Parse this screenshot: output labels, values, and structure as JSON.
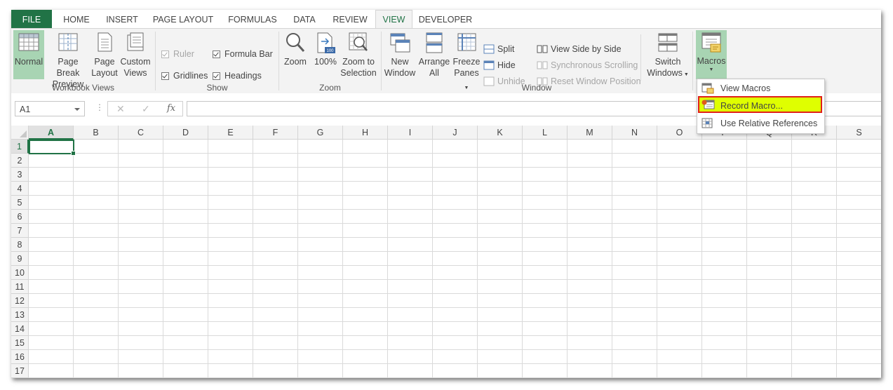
{
  "tabs": [
    "FILE",
    "HOME",
    "INSERT",
    "PAGE LAYOUT",
    "FORMULAS",
    "DATA",
    "REVIEW",
    "VIEW",
    "DEVELOPER"
  ],
  "active_tab": "VIEW",
  "ribbon": {
    "workbook_views": {
      "label": "Workbook Views",
      "normal": "Normal",
      "page_break_1": "Page Break",
      "page_break_2": "Preview",
      "page_layout_1": "Page",
      "page_layout_2": "Layout",
      "custom_1": "Custom",
      "custom_2": "Views"
    },
    "show": {
      "label": "Show",
      "ruler": "Ruler",
      "formula_bar": "Formula Bar",
      "gridlines": "Gridlines",
      "headings": "Headings"
    },
    "zoom": {
      "label": "Zoom",
      "zoom": "Zoom",
      "hundred": "100%",
      "zoom_sel_1": "Zoom to",
      "zoom_sel_2": "Selection"
    },
    "window": {
      "label": "Window",
      "new_1": "New",
      "new_2": "Window",
      "arrange_1": "Arrange",
      "arrange_2": "All",
      "freeze_1": "Freeze",
      "freeze_2": "Panes",
      "split": "Split",
      "hide": "Hide",
      "unhide": "Unhide",
      "side_by_side": "View Side by Side",
      "sync_scroll": "Synchronous Scrolling",
      "reset_pos": "Reset Window Position",
      "switch_1": "Switch",
      "switch_2": "Windows"
    },
    "macros": {
      "label": "Macros"
    }
  },
  "formula_bar": {
    "name_box": "A1",
    "cancel": "✕",
    "enter": "✓",
    "fx": "fx",
    "value": ""
  },
  "grid": {
    "columns": [
      "A",
      "B",
      "C",
      "D",
      "E",
      "F",
      "G",
      "H",
      "I",
      "J",
      "K",
      "L",
      "M",
      "N",
      "O",
      "P",
      "Q",
      "R",
      "S"
    ],
    "rows": [
      "1",
      "2",
      "3",
      "4",
      "5",
      "6",
      "7",
      "8",
      "9",
      "10",
      "11",
      "12",
      "13",
      "14",
      "15",
      "16",
      "17"
    ]
  },
  "macros_menu": {
    "view_macros": "View Macros",
    "record_macro": "Record Macro...",
    "relative_refs": "Use Relative References"
  },
  "colors": {
    "excel_green": "#217346",
    "highlight": "#dfff00",
    "highlight_border": "#e0201a"
  }
}
